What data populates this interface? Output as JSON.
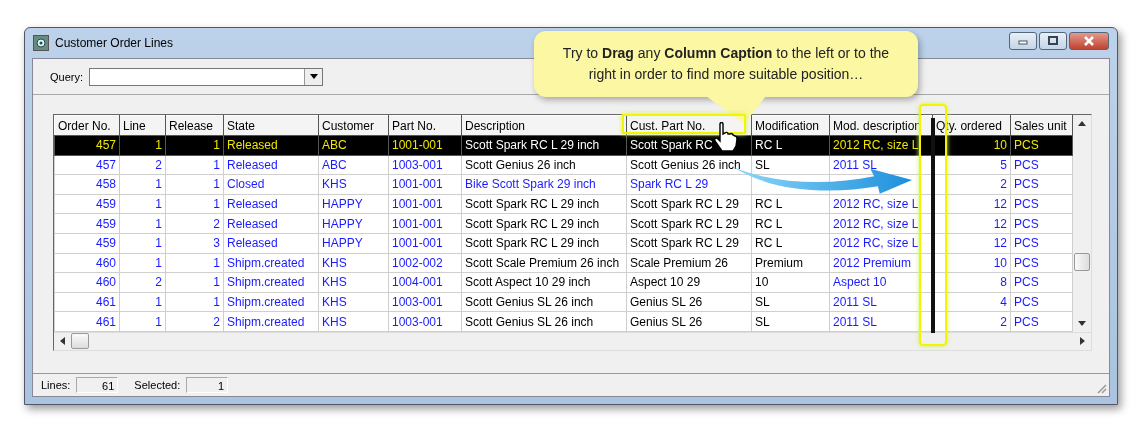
{
  "window": {
    "title": "Customer Order Lines"
  },
  "query": {
    "label": "Query:"
  },
  "callout": {
    "text": "Try to **Drag** any **Column Caption** to the left or to the right in order to find more suitable position…"
  },
  "table": {
    "columns": [
      {
        "label": "Order No.",
        "kind": "key"
      },
      {
        "label": "Line",
        "kind": "key"
      },
      {
        "label": "Release",
        "kind": "key"
      },
      {
        "label": "State",
        "kind": "key"
      },
      {
        "label": "Customer",
        "kind": "key"
      },
      {
        "label": "Part No.",
        "kind": "key"
      },
      {
        "label": "Description",
        "kind": "text"
      },
      {
        "label": "Cust. Part No.",
        "kind": "text"
      },
      {
        "label": "Modification",
        "kind": "plain"
      },
      {
        "label": "Mod. description",
        "kind": "key"
      },
      {
        "label": "Qty. ordered",
        "kind": "key"
      },
      {
        "label": "Sales unit",
        "kind": "key"
      }
    ],
    "rows": [
      {
        "selected": true,
        "kind": "open",
        "cells": [
          "457",
          "1",
          "1",
          "Released",
          "ABC",
          "1001-001",
          "Scott Spark RC L 29 inch",
          "Scott Spark RC",
          "RC L",
          "2012 RC, size L",
          "10",
          "PCS"
        ]
      },
      {
        "selected": false,
        "kind": "open",
        "cells": [
          "457",
          "2",
          "1",
          "Released",
          "ABC",
          "1003-001",
          "Scott Genius 26 inch",
          "Scott Genius 26 inch",
          "SL",
          "2011 SL",
          "5",
          "PCS"
        ]
      },
      {
        "selected": false,
        "kind": "closed",
        "cells": [
          "458",
          "1",
          "1",
          "Closed",
          "KHS",
          "1001-001",
          "Bike Scott Spark 29 inch",
          "Spark RC L 29",
          null,
          null,
          "2",
          "PCS"
        ]
      },
      {
        "selected": false,
        "kind": "open",
        "cells": [
          "459",
          "1",
          "1",
          "Released",
          "HAPPY",
          "1001-001",
          "Scott Spark RC L 29 inch",
          "Scott Spark RC L 29",
          "RC L",
          "2012 RC, size L",
          "12",
          "PCS"
        ]
      },
      {
        "selected": false,
        "kind": "open",
        "cells": [
          "459",
          "1",
          "2",
          "Released",
          "HAPPY",
          "1001-001",
          "Scott Spark RC L 29 inch",
          "Scott Spark RC L 29",
          "RC L",
          "2012 RC, size L",
          "12",
          "PCS"
        ]
      },
      {
        "selected": false,
        "kind": "open",
        "cells": [
          "459",
          "1",
          "3",
          "Released",
          "HAPPY",
          "1001-001",
          "Scott Spark RC L 29 inch",
          "Scott Spark RC L 29",
          "RC L",
          "2012 RC, size L",
          "12",
          "PCS"
        ]
      },
      {
        "selected": false,
        "kind": "open",
        "cells": [
          "460",
          "1",
          "1",
          "Shipm.created",
          "KHS",
          "1002-002",
          "Scott Scale Premium 26 inch",
          "Scale Premium 26",
          "Premium",
          "2012 Premium",
          "10",
          "PCS"
        ]
      },
      {
        "selected": false,
        "kind": "open",
        "cells": [
          "460",
          "2",
          "1",
          "Shipm.created",
          "KHS",
          "1004-001",
          "Scott Aspect 10 29 inch",
          "Aspect 10 29",
          "10",
          "Aspect 10",
          "8",
          "PCS"
        ]
      },
      {
        "selected": false,
        "kind": "open",
        "cells": [
          "461",
          "1",
          "1",
          "Shipm.created",
          "KHS",
          "1003-001",
          "Scott Genius SL 26 inch",
          "Genius SL 26",
          "SL",
          "2011 SL",
          "4",
          "PCS"
        ]
      },
      {
        "selected": false,
        "kind": "open",
        "cells": [
          "461",
          "1",
          "2",
          "Shipm.created",
          "KHS",
          "1003-001",
          "Scott Genius SL 26 inch",
          "Genius SL 26",
          "SL",
          "2011 SL",
          "2",
          "PCS"
        ]
      }
    ]
  },
  "status_bar": [
    {
      "label": "Lines:",
      "value": "61"
    },
    {
      "label": "Selected:",
      "value": "1"
    }
  ]
}
